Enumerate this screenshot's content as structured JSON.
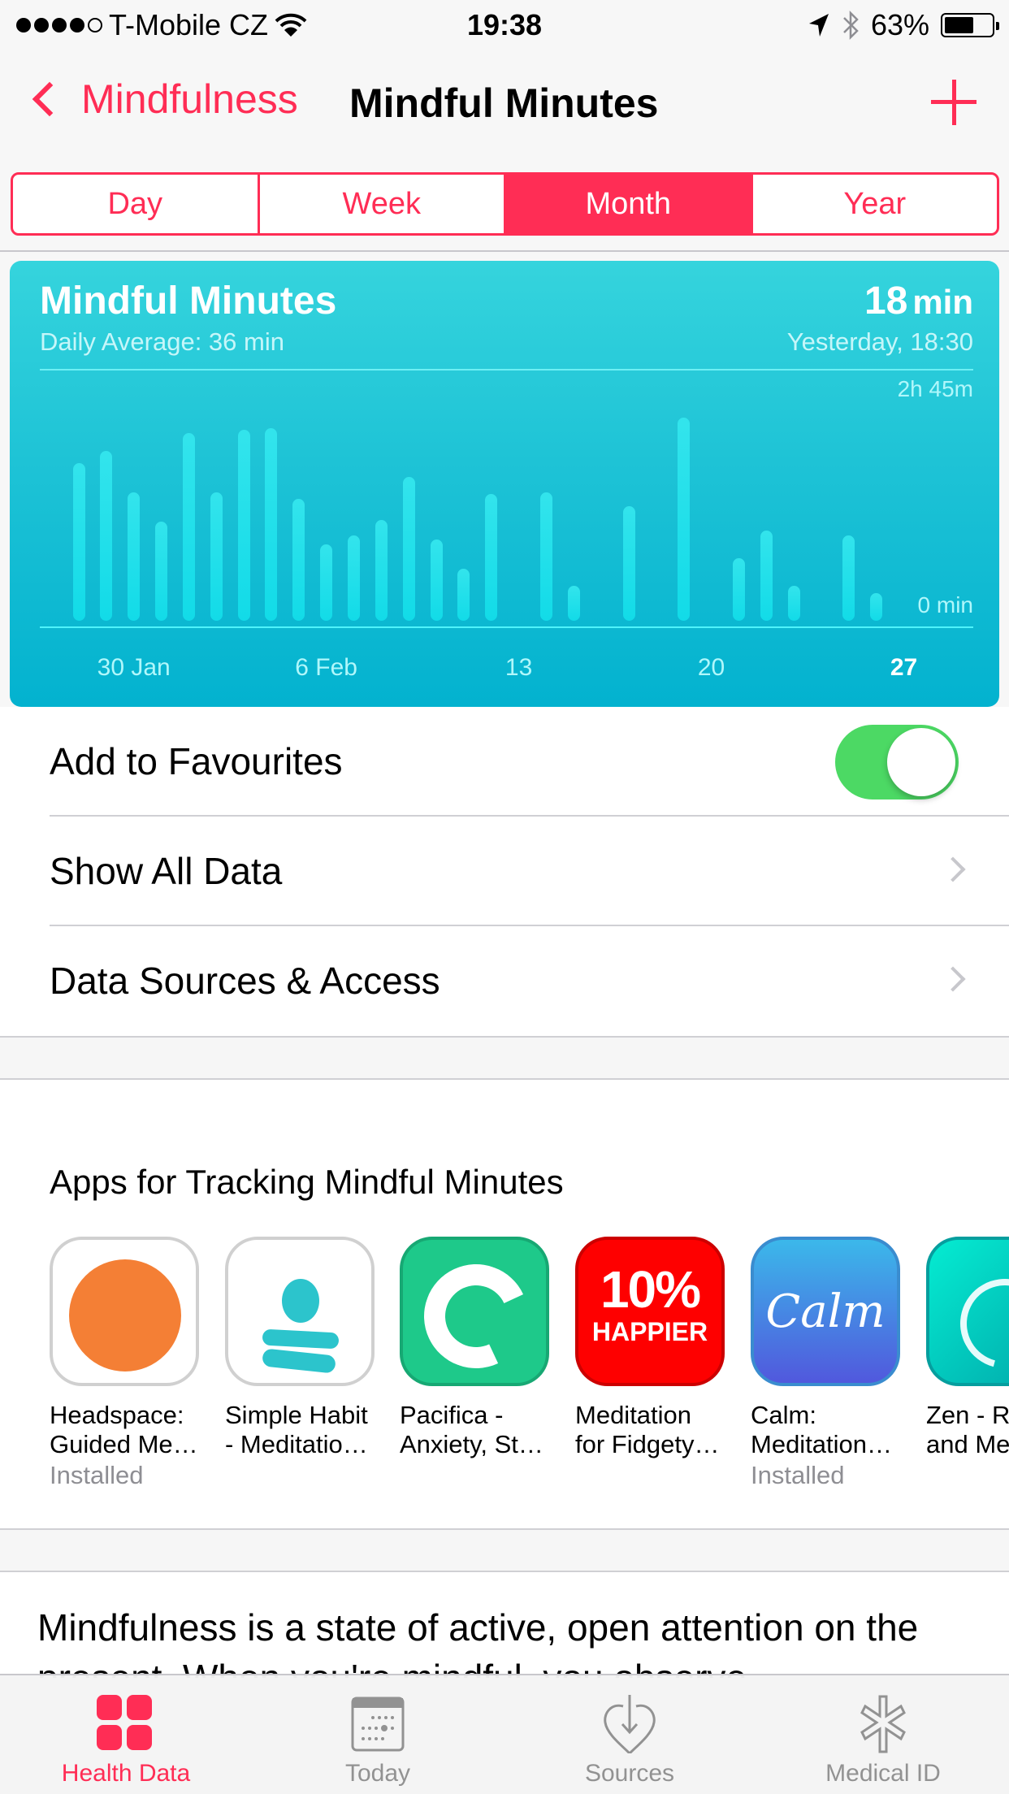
{
  "status_bar": {
    "signal_bars_filled": 4,
    "signal_bars_total": 5,
    "carrier": "T-Mobile CZ",
    "wifi_icon": "wifi-icon",
    "time": "19:38",
    "location_icon": "location-arrow-icon",
    "bluetooth_icon": "bluetooth-icon",
    "battery_percent_label": "63%",
    "battery_level": 0.63
  },
  "nav": {
    "back_label": "Mindfulness",
    "title": "Mindful Minutes",
    "add_icon": "plus-icon"
  },
  "segments": {
    "items": [
      "Day",
      "Week",
      "Month",
      "Year"
    ],
    "selected": "Month"
  },
  "chart_card": {
    "title": "Mindful Minutes",
    "daily_average": "Daily Average: 36 min",
    "latest_value": "18",
    "latest_unit": "min",
    "latest_time": "Yesterday, 18:30",
    "accent": "#1ec3d6"
  },
  "chart_data": {
    "type": "bar",
    "title": "Mindful Minutes",
    "ylabel": "minutes",
    "ylim": [
      0,
      165
    ],
    "y_tick_labels": {
      "max": "2h 45m",
      "min": "0 min"
    },
    "x_tick_labels": [
      "30 Jan",
      "6 Feb",
      "13",
      "20",
      "27"
    ],
    "x_tick_days": [
      2,
      9,
      16,
      23,
      30
    ],
    "highlight_tick": "27",
    "categories": [
      "28 Jan",
      "29 Jan",
      "30 Jan",
      "31 Jan",
      "1 Feb",
      "2 Feb",
      "3 Feb",
      "4 Feb",
      "5 Feb",
      "6 Feb",
      "7 Feb",
      "8 Feb",
      "9 Feb",
      "10 Feb",
      "11 Feb",
      "12 Feb",
      "13 Feb",
      "14 Feb",
      "15 Feb",
      "16 Feb",
      "17 Feb",
      "18 Feb",
      "19 Feb",
      "20 Feb",
      "21 Feb",
      "22 Feb",
      "23 Feb",
      "24 Feb",
      "25 Feb",
      "26 Feb",
      "27 Feb"
    ],
    "values": [
      103,
      111,
      84,
      65,
      123,
      84,
      125,
      126,
      80,
      50,
      56,
      66,
      94,
      53,
      34,
      83,
      0,
      84,
      23,
      0,
      75,
      0,
      133,
      0,
      41,
      59,
      23,
      0,
      56,
      18,
      0
    ]
  },
  "list": {
    "favourites_label": "Add to Favourites",
    "favourites_on": true,
    "show_all_label": "Show All Data",
    "sources_label": "Data Sources & Access"
  },
  "apps": {
    "title": "Apps for Tracking Mindful Minutes",
    "items": [
      {
        "name": "Headspace:\nGuided Me…",
        "status": "Installed",
        "icon": "headspace-icon"
      },
      {
        "name": "Simple Habit\n- Meditatio…",
        "status": "",
        "icon": "simple-habit-icon"
      },
      {
        "name": "Pacifica -\nAnxiety, St…",
        "status": "",
        "icon": "pacifica-icon"
      },
      {
        "name": "Meditation\nfor Fidgety…",
        "status": "",
        "icon": "ten-percent-happier-icon",
        "icon_text_big": "10%",
        "icon_text_small": "HAPPIER"
      },
      {
        "name": "Calm:\nMeditation…",
        "status": "Installed",
        "icon": "calm-icon",
        "icon_text": "Calm"
      },
      {
        "name": "Zen - R\nand Me",
        "status": "",
        "icon": "zen-icon"
      }
    ]
  },
  "description": "Mindfulness is a state of active, open attention on the present. When you're mindful, you observe",
  "tabbar": {
    "items": [
      {
        "label": "Health Data",
        "icon": "health-data-icon",
        "active": true
      },
      {
        "label": "Today",
        "icon": "calendar-icon",
        "active": false
      },
      {
        "label": "Sources",
        "icon": "sources-heart-icon",
        "active": false
      },
      {
        "label": "Medical ID",
        "icon": "medical-id-icon",
        "active": false
      }
    ],
    "active_color": "#ff2d55"
  }
}
